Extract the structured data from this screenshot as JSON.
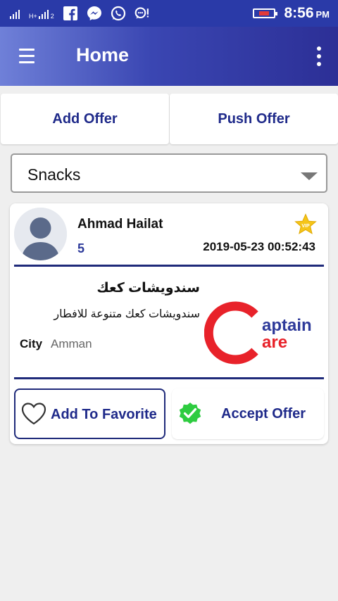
{
  "status_bar": {
    "network_label": "H+",
    "sim_label": "2",
    "time": "8:56",
    "ampm": "PM",
    "icons": [
      "signal-icon",
      "facebook-icon",
      "messenger-icon",
      "whatsapp-icon",
      "chat-alert-icon",
      "battery-icon"
    ]
  },
  "app_bar": {
    "title": "Home"
  },
  "tabs": [
    {
      "label": "Add Offer"
    },
    {
      "label": "Push Offer"
    }
  ],
  "category_select": {
    "selected": "Snacks"
  },
  "offer": {
    "user_name": "Ahmad Hailat",
    "count": "5",
    "datetime": "2019-05-23 00:52:43",
    "title": "سندويشات كعك",
    "description": "سندويشات كعك متنوعة للافطار",
    "city_label": "City",
    "city_value": "Amman",
    "logo": {
      "line1": "aptain",
      "line2": "are"
    },
    "favorite_label": "Add To Favorite",
    "accept_label": "Accept Offer"
  },
  "colors": {
    "status_bar": "#2a3aa8",
    "accent_text": "#1f2a8a",
    "star": "#f5c518",
    "check": "#2ecc40",
    "logo_red": "#e8222a"
  }
}
